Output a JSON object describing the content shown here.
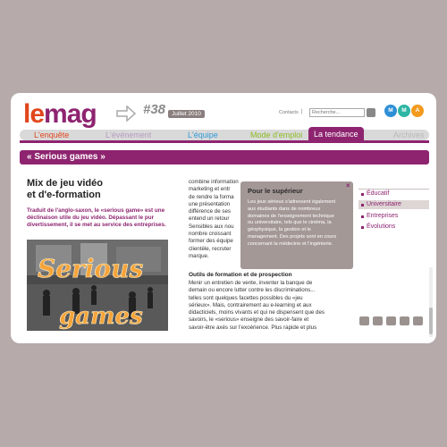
{
  "header": {
    "logo_le": "le",
    "logo_mag": "mag",
    "issue": "#38",
    "date": "Juillet 2010",
    "contacts": "Contacts",
    "separator": "|",
    "search_placeholder": "Recherche...",
    "badges": [
      "M",
      "M",
      "A"
    ],
    "badge_colors": [
      "#2f8fd6",
      "#2db6a4",
      "#f39a1e"
    ]
  },
  "nav": {
    "items": [
      "L'enquête",
      "L'événement",
      "L'équipe",
      "Mode d'emploi",
      "La tendance",
      "Archives"
    ],
    "colors": [
      "#e2461d",
      "#b49cbf",
      "#2f9bd8",
      "#8cbc22",
      "#ffffff",
      "#b9b9b9"
    ],
    "active_index": 4
  },
  "section": {
    "title": "« Serious games »"
  },
  "article": {
    "title_line1": "Mix de jeu vidéo",
    "title_line2": "et d'e-formation",
    "intro_line1": "Traduit de l'anglo-saxon, le «serious game» est une",
    "intro_line2": "déclinaison utile du jeu vidéo. Dépassant le pur",
    "intro_line3": "divertissement, il se met au service des entreprises.",
    "hero_text_1": "Serious",
    "hero_text_2": "games"
  },
  "body": {
    "top_lines": [
      "combine information",
      "marketing et entr",
      "de rendre la forma",
      "une présentation",
      "différence de ses",
      "entend un retour",
      "Sensibles aux nou",
      "nombre croissant",
      "former des équipe",
      "clientèle, recruter",
      "marque."
    ],
    "subhead": "Outils de formation et de prospection",
    "bottom_lines": [
      "Menir un entretien de vente, inventer la banque de",
      "demain ou encore lutter contre les discriminations...",
      "telles sont quelques facettes possibles du «jeu",
      "sérieux». Mais, contrairement au e-learning et aux",
      "didacticiels, moins vivants et qui ne dispensent que des",
      "savoirs, le «serious» enseigne des savoir-faire et",
      "savoir-être axés sur l'exoérience. Plus rapide et plus"
    ]
  },
  "popup": {
    "title": "Pour le supérieur",
    "close": "×",
    "lines": [
      "Les jeux sérieux s'adressent également",
      "aux étudiants dans de nombreux",
      "domaines de l'enseignement technique",
      "ou universitaire, tels que le cinéma, la",
      "géophysique, la gestion et le",
      "management. Des projets sont en cours",
      "concernant la médecine et l'ingénierie."
    ]
  },
  "sidebar": {
    "items": [
      "Éducatif",
      "Universitaire",
      "Entreprises",
      "Évolutions"
    ],
    "active_index": 1
  }
}
